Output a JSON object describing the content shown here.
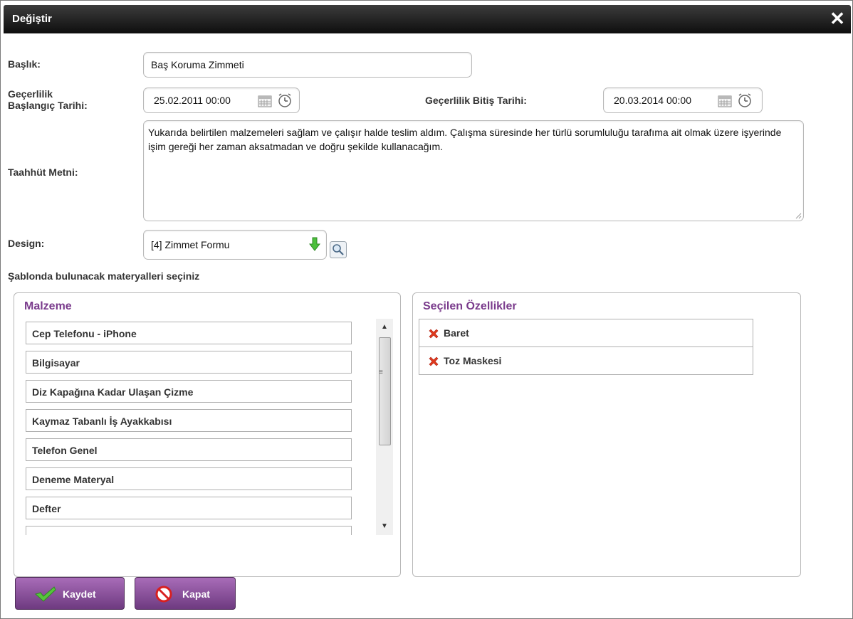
{
  "dialog": {
    "title": "Değiştir",
    "close_icon": "close-icon"
  },
  "form": {
    "baslik_label": "Başlık:",
    "baslik_value": "Baş Koruma Zimmeti",
    "gecerlilik_baslangic_label_line1": "Geçerlilik",
    "gecerlilik_baslangic_label_line2": "Başlangıç Tarihi:",
    "gecerlilik_baslangic_value": "25.02.2011 00:00",
    "gecerlilik_bitis_label": "Geçerlilik Bitiş Tarihi:",
    "gecerlilik_bitis_value": "20.03.2014 00:00",
    "taahhut_label": "Taahhüt Metni:",
    "taahhut_value": "Yukarıda belirtilen malzemeleri sağlam ve çalışır halde teslim aldım. Çalışma süresinde her türlü sorumluluğu tarafıma ait olmak üzere işyerinde işim gereği her zaman aksatmadan ve doğru şekilde kullanacağım.",
    "design_label": "Design:",
    "design_value": "[4] Zimmet Formu"
  },
  "section_title": "Şablonda bulunacak materyalleri seçiniz",
  "malzeme_panel": {
    "title": "Malzeme",
    "items": [
      "Cep Telefonu - iPhone",
      "Bilgisayar",
      "Diz Kapağına Kadar Ulaşan Çizme",
      "Kaymaz Tabanlı İş Ayakkabısı",
      "Telefon Genel",
      "Deneme Materyal",
      "Defter"
    ]
  },
  "secilen_panel": {
    "title": "Seçilen Özellikler",
    "items": [
      "Baret",
      "Toz Maskesi"
    ]
  },
  "buttons": {
    "save_label": "Kaydet",
    "close_label": "Kapat"
  },
  "colors": {
    "accent_purple": "#7a3b8c",
    "button_purple": "#8c50a0",
    "titlebar": "#1a1a1a",
    "check_green": "#3cb43c",
    "cancel_red": "#d82020"
  }
}
